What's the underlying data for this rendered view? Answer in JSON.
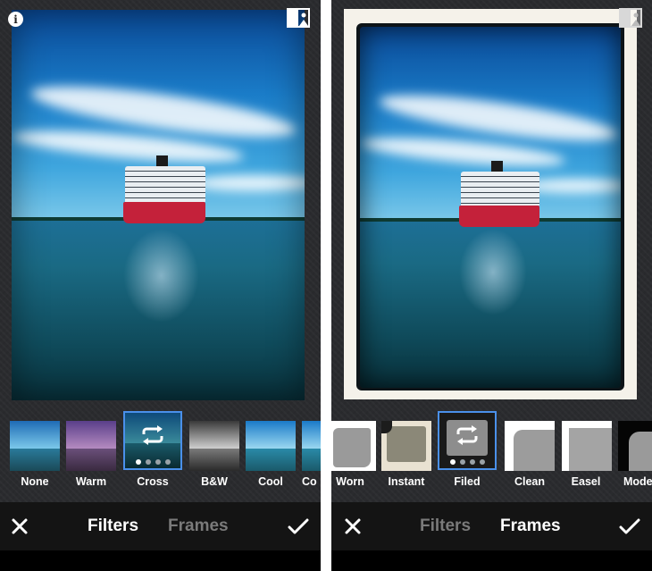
{
  "left_screen": {
    "info_icon": "i",
    "icons": {
      "info": "info-icon",
      "compare": "compare-icon",
      "close": "close-icon",
      "confirm": "checkmark-icon",
      "repeat": "repeat-icon"
    },
    "thumbnails": [
      {
        "label": "None"
      },
      {
        "label": "Warm"
      },
      {
        "label": "Cross",
        "selected": true
      },
      {
        "label": "B&W"
      },
      {
        "label": "Cool"
      },
      {
        "label": "Co"
      }
    ],
    "tabs": {
      "filters": "Filters",
      "frames": "Frames"
    },
    "active_tab": "Filters"
  },
  "right_screen": {
    "icons": {
      "compare": "compare-icon",
      "close": "close-icon",
      "confirm": "checkmark-icon",
      "repeat": "repeat-icon"
    },
    "thumbnails": [
      {
        "label": "Worn"
      },
      {
        "label": "Instant"
      },
      {
        "label": "Filed",
        "selected": true
      },
      {
        "label": "Clean"
      },
      {
        "label": "Easel"
      },
      {
        "label": "Mode"
      }
    ],
    "tabs": {
      "filters": "Filters",
      "frames": "Frames"
    },
    "active_tab": "Frames"
  },
  "colors": {
    "selection_border": "#4a90ea",
    "bar_background": "#141414",
    "active_tab": "#ffffff",
    "inactive_tab": "#7a7a7a"
  }
}
